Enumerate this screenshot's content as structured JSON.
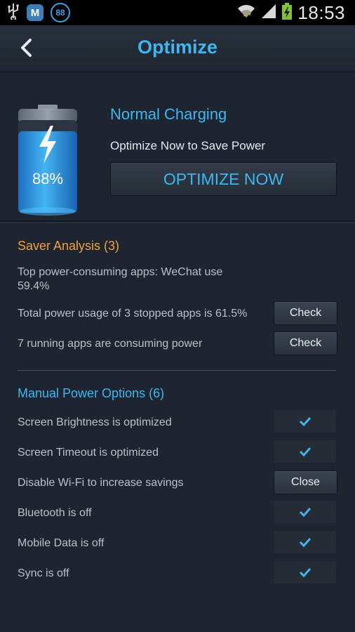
{
  "status_bar": {
    "time": "18:53",
    "notif_badge": "88",
    "notif_app": "M",
    "battery_color": "#7ec23b"
  },
  "header": {
    "title": "Optimize"
  },
  "hero": {
    "battery_percent": "88%",
    "battery_level": 0.88,
    "charge_status": "Normal Charging",
    "tip": "Optimize Now to Save Power",
    "optimize_label": "OPTIMIZE NOW"
  },
  "saver_analysis": {
    "title": "Saver Analysis (3)",
    "rows": [
      {
        "text": "Top power-consuming apps: WeChat use 59.4%"
      },
      {
        "text": "Total power usage of 3 stopped apps is 61.5%",
        "button": "Check"
      },
      {
        "text": "7 running apps are consuming power",
        "button": "Check"
      }
    ]
  },
  "manual_options": {
    "title": "Manual Power Options (6)",
    "rows": [
      {
        "text": "Screen Brightness is optimized",
        "status": "checked"
      },
      {
        "text": "Screen Timeout is optimized",
        "status": "checked"
      },
      {
        "text": "Disable Wi-Fi to increase savings",
        "button": "Close"
      },
      {
        "text": "Bluetooth is off",
        "status": "checked"
      },
      {
        "text": "Mobile Data is off",
        "status": "checked"
      },
      {
        "text": "Sync is off",
        "status": "checked"
      }
    ]
  },
  "colors": {
    "accent_blue": "#3fb6f0",
    "accent_orange": "#f0a040",
    "background": "#1e2530"
  }
}
